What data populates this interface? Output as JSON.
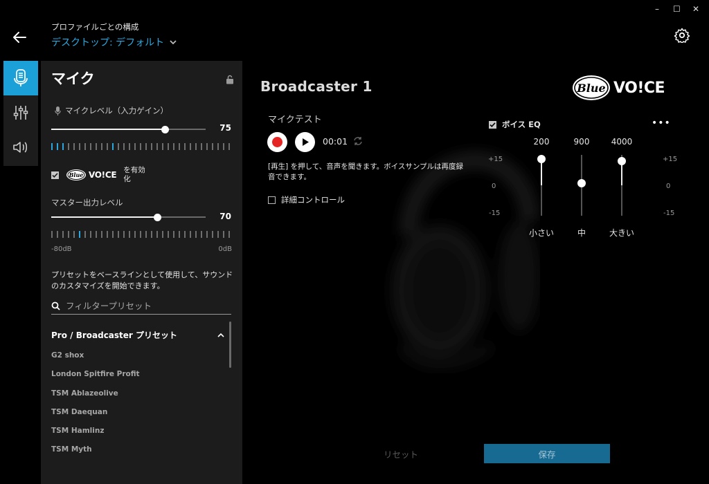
{
  "header": {
    "profile_caption": "プロファイルごとの構成",
    "profile_selected": "デスクトップ: デフォルト"
  },
  "panel": {
    "title": "マイク",
    "mic_level_label": "マイクレベル（入力ゲイン）",
    "mic_level_value": "75",
    "blue_voice_label_suffix": "を有効化",
    "master_level_label": "マスター出力レベル",
    "master_level_value": "70",
    "db_min": "-80dB",
    "db_max": "0dB",
    "description": "プリセットをベースラインとして使用して、サウンドのカスタマイズを開始できます。",
    "filter_placeholder": "フィルタープリセット",
    "preset_group_title": "Pro / Broadcaster プリセット",
    "presets": [
      "G2 shox",
      "London Spitfire Profit",
      "TSM Ablazeolive",
      "TSM Daequan",
      "TSM Hamlinz",
      "TSM Myth"
    ]
  },
  "main": {
    "preset_name": "Broadcaster 1",
    "mic_test_label": "マイクテスト",
    "timer": "00:01",
    "hint": "[再生] を押して、音声を聞きます。ボイスサンプルは再度録音できます。",
    "advanced_controls": "詳細コントロール",
    "voice_eq_label": "ボイス EQ",
    "more_dots": "•••",
    "eq_db_labels": [
      "+15",
      "0",
      "-15"
    ],
    "eq_bands": [
      {
        "freq": "200",
        "name": "小さい",
        "gain": 13
      },
      {
        "freq": "900",
        "name": "中",
        "gain": 1
      },
      {
        "freq": "4000",
        "name": "大きい",
        "gain": 12
      }
    ],
    "reset_label": "リセット",
    "save_label": "保存"
  },
  "logo": {
    "blue_text": "Blue",
    "voice_text": "VO!CE"
  },
  "colors": {
    "accent": "#1ba0d8",
    "profile_link": "#29a9e0",
    "record_red": "#e52424",
    "save_bg": "#176b92"
  }
}
